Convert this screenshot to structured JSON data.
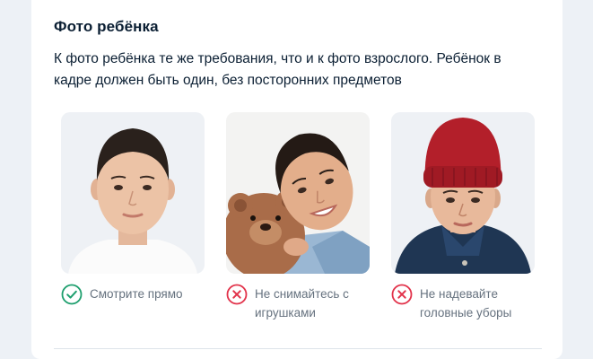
{
  "section": {
    "title": "Фото ребёнка",
    "description": "К фото ребёнка те же требования, что и к фото взрослого. Ребёнок в кадре должен быть один, без посторонних предметов"
  },
  "examples": [
    {
      "caption": "Смотрите прямо",
      "status": "ok",
      "status_icon": "check-circle-icon",
      "color": "#1e9f6e"
    },
    {
      "caption": "Не снимайтесь с игрушками",
      "status": "bad",
      "status_icon": "cross-circle-icon",
      "color": "#e2334b"
    },
    {
      "caption": "Не надевайте головные уборы",
      "status": "bad",
      "status_icon": "cross-circle-icon",
      "color": "#e2334b"
    }
  ]
}
